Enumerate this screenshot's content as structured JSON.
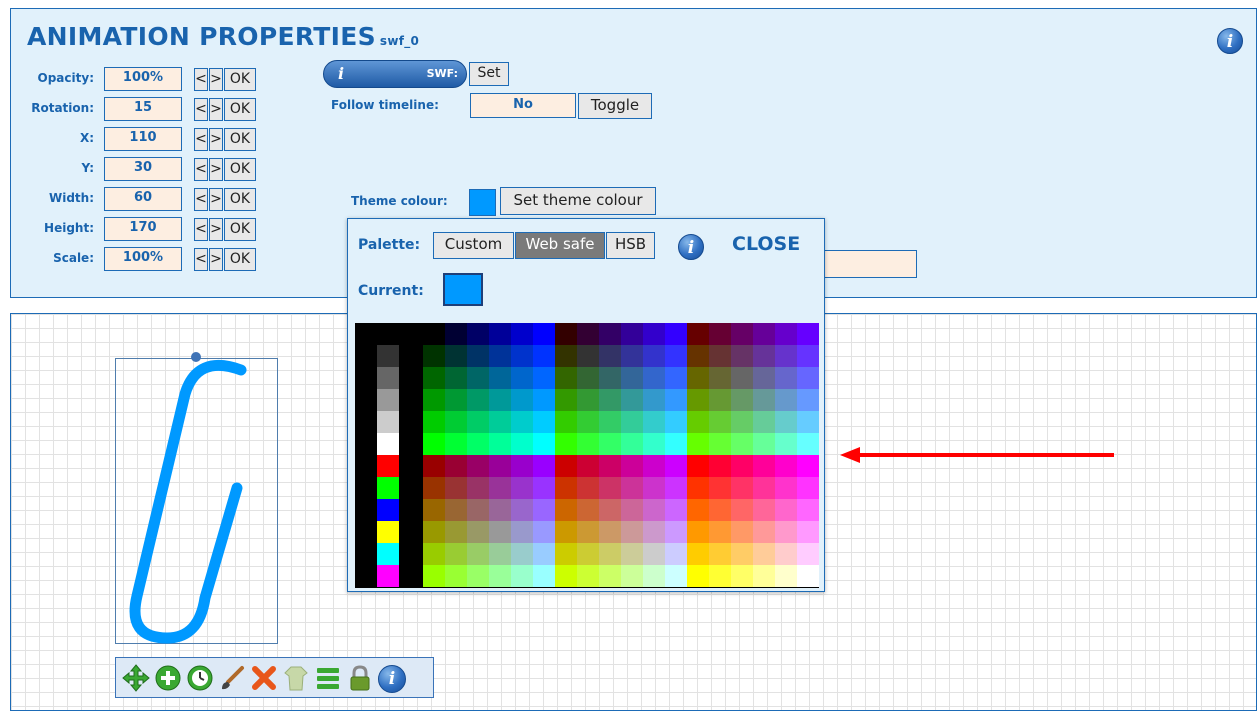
{
  "header": {
    "title": "ANIMATION PROPERTIES",
    "subtitle": "swf_0",
    "info_glyph": "i"
  },
  "properties": [
    {
      "label": "Opacity:",
      "value": "100%"
    },
    {
      "label": "Rotation:",
      "value": "15"
    },
    {
      "label": "X:",
      "value": "110"
    },
    {
      "label": "Y:",
      "value": "30"
    },
    {
      "label": "Width:",
      "value": "60"
    },
    {
      "label": "Height:",
      "value": "170"
    },
    {
      "label": "Scale:",
      "value": "100%"
    }
  ],
  "stepper": {
    "dec": "<",
    "inc": ">",
    "ok": "OK"
  },
  "swf": {
    "info_glyph": "i",
    "label": "SWF:",
    "set_label": "Set"
  },
  "follow": {
    "label": "Follow timeline:",
    "value": "No",
    "toggle_label": "Toggle"
  },
  "theme": {
    "label": "Theme colour:",
    "color": "#0099ff",
    "button_label": "Set theme colour"
  },
  "palette": {
    "label": "Palette:",
    "tabs": [
      "Custom",
      "Web safe",
      "HSB"
    ],
    "active_tab": "Web safe",
    "info_glyph": "i",
    "close_label": "CLOSE",
    "current_label": "Current:",
    "current_color": "#0099ff"
  },
  "toolbar": {
    "icons": [
      "move-icon",
      "add-icon",
      "timer-icon",
      "brush-icon",
      "delete-icon",
      "clothes-icon",
      "menu-icon",
      "lock-icon",
      "info-icon"
    ],
    "info_glyph": "i"
  },
  "colors": {
    "accent": "#1963ad",
    "panel_bg": "#e1f1fb",
    "field_bg": "#fdeee1",
    "shape_stroke": "#0099ff",
    "arrow": "#ff0000"
  }
}
